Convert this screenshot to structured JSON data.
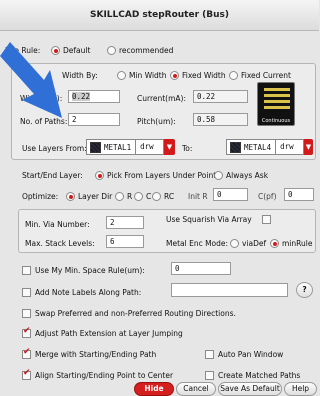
{
  "window": {
    "title": "SKILLCAD stepRouter (Bus)"
  },
  "use_rule": {
    "label": "Use Rule:",
    "opt_default": "Default",
    "opt_recommended": "recommended"
  },
  "width": {
    "by_label": "Width By:",
    "opt_min": "Min Width",
    "opt_fixed": "Fixed Width",
    "opt_current": "Fixed Current",
    "width_label": "Width(um):",
    "width_value": "0.22",
    "current_label": "Current(mA):",
    "current_value": "0.22",
    "paths_label": "No. of Paths:",
    "paths_value": "2",
    "pitch_label": "Pitch(um):",
    "pitch_value": "0.58",
    "continuous_label": "Continuous"
  },
  "layers": {
    "from_label": "Use Layers From:",
    "from_layer": "METAL1",
    "from_purpose": "drw",
    "to_label": "To:",
    "to_layer": "METAL4",
    "to_purpose": "drw"
  },
  "start_end": {
    "label": "Start/End Layer:",
    "opt_pick": "Pick From Layers Under Point",
    "opt_ask": "Always Ask"
  },
  "optimize": {
    "label": "Optimize:",
    "opt_layerdir": "Layer Dir",
    "opt_r": "R",
    "opt_c": "C",
    "opt_rc": "RC",
    "initr_label": "Init R",
    "initr_value": "0",
    "cpf_label": "C(pf)",
    "cpf_value": "0"
  },
  "via": {
    "min_label": "Min. Via Number:",
    "min_value": "2",
    "stack_label": "Max. Stack Levels:",
    "stack_value": "6",
    "squarish_label": "Use Squarish Via Array",
    "enc_label": "Metal Enc Mode:",
    "opt_viadef": "viaDef",
    "opt_minrule": "minRule"
  },
  "options": {
    "min_space_label": "Use My Min. Space Rule(um):",
    "min_space_value": "0",
    "note_labels": "Add Note Labels Along Path:",
    "help_q": "?",
    "swap_dirs": "Swap Preferred and non-Preferred Routing Directions.",
    "adjust_ext": "Adjust Path Extension at Layer Jumping",
    "merge": "Merge with Starting/Ending Path",
    "auto_pan": "Auto Pan Window",
    "align": "Align Starting/Ending Point to Center",
    "create_matched": "Create Matched Paths"
  },
  "buttons": {
    "hide": "Hide",
    "cancel": "Cancel",
    "save_default": "Save As Default",
    "help": "Help"
  },
  "colors": {
    "accent_red": "#d21a1a",
    "arrow_blue": "#2f6fd6"
  }
}
